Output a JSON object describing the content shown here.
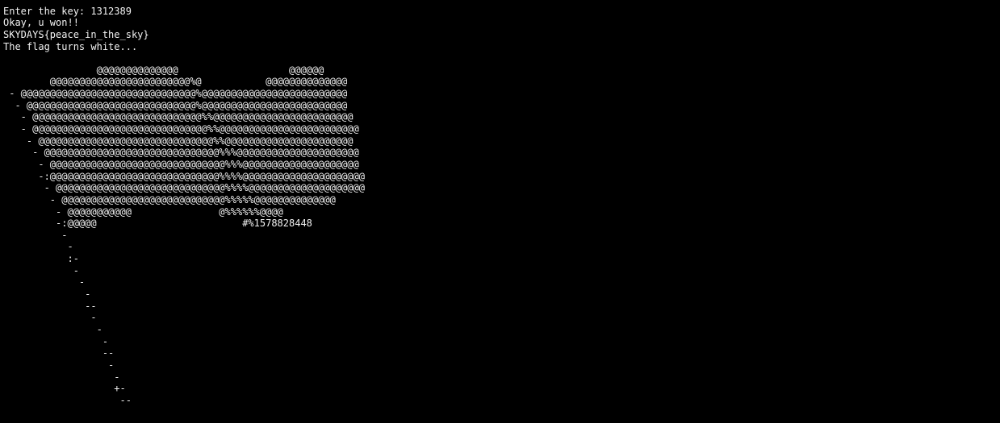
{
  "terminal": {
    "background": "#000000",
    "foreground": "#f2f2f2",
    "lines": [
      "",
      "Enter the key: 1312389",
      "Okay, u won!!",
      "SKYDAYS{peace_in_the_sky}",
      "The flag turns white...",
      "",
      "                @@@@@@@@@@@@@@                   @@@@@@",
      "        @@@@@@@@@@@@@@@@@@@@@@@@%@           @@@@@@@@@@@@@@",
      " - @@@@@@@@@@@@@@@@@@@@@@@@@@@@@@%@@@@@@@@@@@@@@@@@@@@@@@@@",
      "  - @@@@@@@@@@@@@@@@@@@@@@@@@@@@@%@@@@@@@@@@@@@@@@@@@@@@@@@",
      "   - @@@@@@@@@@@@@@@@@@@@@@@@@@@@@%%@@@@@@@@@@@@@@@@@@@@@@@@",
      "   - @@@@@@@@@@@@@@@@@@@@@@@@@@@@@@%%@@@@@@@@@@@@@@@@@@@@@@@@",
      "    - @@@@@@@@@@@@@@@@@@@@@@@@@@@@@@%%@@@@@@@@@@@@@@@@@@@@@@",
      "     - @@@@@@@@@@@@@@@@@@@@@@@@@@@@@@%%%@@@@@@@@@@@@@@@@@@@@@",
      "      - @@@@@@@@@@@@@@@@@@@@@@@@@@@@@@%%%@@@@@@@@@@@@@@@@@@@@",
      "      -:@@@@@@@@@@@@@@@@@@@@@@@@@@@@@%%%%@@@@@@@@@@@@@@@@@@@@@",
      "       - @@@@@@@@@@@@@@@@@@@@@@@@@@@@@%%%%@@@@@@@@@@@@@@@@@@@@",
      "        - @@@@@@@@@@@@@@@@@@@@@@@@@@@@%%%%%@@@@@@@@@@@@@@",
      "         - @@@@@@@@@@@               @%%%%%%@@@@",
      "         -:@@@@@                         #%1578828448",
      "          -",
      "           -",
      "           :-",
      "            -",
      "             -",
      "              -",
      "              --",
      "               -",
      "                -",
      "                 -",
      "                 --",
      "                  -",
      "                   -",
      "                   +-",
      "                    --"
    ]
  }
}
